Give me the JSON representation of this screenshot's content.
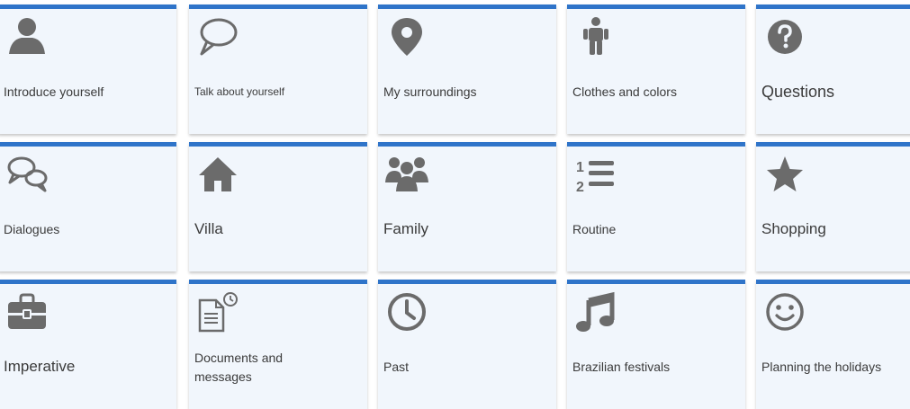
{
  "icon_color": "#6b6b6b",
  "accent_color": "#2f74c9",
  "tiles": [
    {
      "label": "Introduce yourself",
      "icon": "person-icon"
    },
    {
      "label": "Talk about yourself",
      "icon": "speech-bubble-icon"
    },
    {
      "label": "My surroundings",
      "icon": "map-pin-icon"
    },
    {
      "label": "Clothes and colors",
      "icon": "child-figure-icon"
    },
    {
      "label": "Questions",
      "icon": "question-circle-icon"
    },
    {
      "label": "Dialogues",
      "icon": "two-speech-bubbles-icon"
    },
    {
      "label": "Villa",
      "icon": "house-icon"
    },
    {
      "label": "Family",
      "icon": "group-people-icon"
    },
    {
      "label": "Routine",
      "icon": "numbered-list-icon"
    },
    {
      "label": "Shopping",
      "icon": "star-icon"
    },
    {
      "label": "Imperative",
      "icon": "briefcase-icon"
    },
    {
      "label": "Documents and messages",
      "icon": "document-clock-icon"
    },
    {
      "label": "Past",
      "icon": "clock-icon"
    },
    {
      "label": "Brazilian festivals",
      "icon": "music-note-icon"
    },
    {
      "label": "Planning the holidays",
      "icon": "smiley-icon"
    }
  ]
}
